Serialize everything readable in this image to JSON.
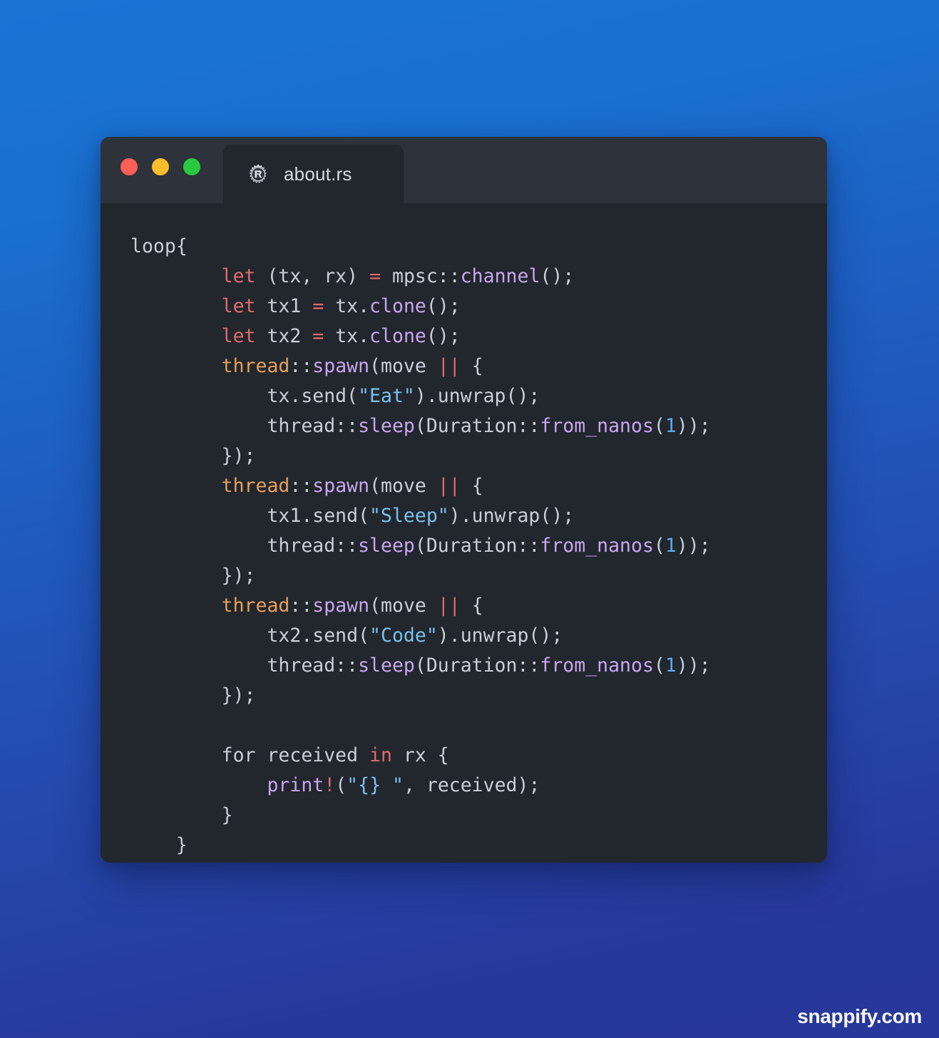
{
  "window": {
    "traffic_lights": [
      {
        "name": "close",
        "color": "#ff5f56"
      },
      {
        "name": "minimize",
        "color": "#fdbc2c"
      },
      {
        "name": "zoom",
        "color": "#27c93f"
      }
    ],
    "tab": {
      "icon": "rust-logo-icon",
      "label": "about.rs"
    }
  },
  "editor": {
    "language": "rust",
    "background": "#22262d",
    "titlebar_background": "#2e323b",
    "lines": [
      [
        {
          "t": "loop{",
          "c": "t-pl"
        }
      ],
      [
        {
          "t": "        ",
          "c": "t-pl"
        },
        {
          "t": "let",
          "c": "t-key"
        },
        {
          "t": " (tx, rx) ",
          "c": "t-pl"
        },
        {
          "t": "=",
          "c": "t-op"
        },
        {
          "t": " mpsc::",
          "c": "t-pl"
        },
        {
          "t": "channel",
          "c": "t-fn"
        },
        {
          "t": "();",
          "c": "t-pl"
        }
      ],
      [
        {
          "t": "        ",
          "c": "t-pl"
        },
        {
          "t": "let",
          "c": "t-key"
        },
        {
          "t": " tx1 ",
          "c": "t-pl"
        },
        {
          "t": "=",
          "c": "t-op"
        },
        {
          "t": " tx.",
          "c": "t-pl"
        },
        {
          "t": "clone",
          "c": "t-fn"
        },
        {
          "t": "();",
          "c": "t-pl"
        }
      ],
      [
        {
          "t": "        ",
          "c": "t-pl"
        },
        {
          "t": "let",
          "c": "t-key"
        },
        {
          "t": " tx2 ",
          "c": "t-pl"
        },
        {
          "t": "=",
          "c": "t-op"
        },
        {
          "t": " tx.",
          "c": "t-pl"
        },
        {
          "t": "clone",
          "c": "t-fn"
        },
        {
          "t": "();",
          "c": "t-pl"
        }
      ],
      [
        {
          "t": "        ",
          "c": "t-pl"
        },
        {
          "t": "thread",
          "c": "t-mod"
        },
        {
          "t": "::",
          "c": "t-pl"
        },
        {
          "t": "spawn",
          "c": "t-fn"
        },
        {
          "t": "(move ",
          "c": "t-pl"
        },
        {
          "t": "||",
          "c": "t-op"
        },
        {
          "t": " {",
          "c": "t-pl"
        }
      ],
      [
        {
          "t": "            tx.send(",
          "c": "t-pl"
        },
        {
          "t": "\"Eat\"",
          "c": "t-str"
        },
        {
          "t": ").unwrap();",
          "c": "t-pl"
        }
      ],
      [
        {
          "t": "            thread::",
          "c": "t-pl"
        },
        {
          "t": "sleep",
          "c": "t-fn"
        },
        {
          "t": "(Duration::",
          "c": "t-pl"
        },
        {
          "t": "from_nanos",
          "c": "t-fn"
        },
        {
          "t": "(",
          "c": "t-pl"
        },
        {
          "t": "1",
          "c": "t-num"
        },
        {
          "t": "));",
          "c": "t-pl"
        }
      ],
      [
        {
          "t": "        });",
          "c": "t-pl"
        }
      ],
      [
        {
          "t": "        ",
          "c": "t-pl"
        },
        {
          "t": "thread",
          "c": "t-mod"
        },
        {
          "t": "::",
          "c": "t-pl"
        },
        {
          "t": "spawn",
          "c": "t-fn"
        },
        {
          "t": "(move ",
          "c": "t-pl"
        },
        {
          "t": "||",
          "c": "t-op"
        },
        {
          "t": " {",
          "c": "t-pl"
        }
      ],
      [
        {
          "t": "            tx1.send(",
          "c": "t-pl"
        },
        {
          "t": "\"Sleep\"",
          "c": "t-str"
        },
        {
          "t": ").unwrap();",
          "c": "t-pl"
        }
      ],
      [
        {
          "t": "            thread::",
          "c": "t-pl"
        },
        {
          "t": "sleep",
          "c": "t-fn"
        },
        {
          "t": "(Duration::",
          "c": "t-pl"
        },
        {
          "t": "from_nanos",
          "c": "t-fn"
        },
        {
          "t": "(",
          "c": "t-pl"
        },
        {
          "t": "1",
          "c": "t-num"
        },
        {
          "t": "));",
          "c": "t-pl"
        }
      ],
      [
        {
          "t": "        });",
          "c": "t-pl"
        }
      ],
      [
        {
          "t": "        ",
          "c": "t-pl"
        },
        {
          "t": "thread",
          "c": "t-mod"
        },
        {
          "t": "::",
          "c": "t-pl"
        },
        {
          "t": "spawn",
          "c": "t-fn"
        },
        {
          "t": "(move ",
          "c": "t-pl"
        },
        {
          "t": "||",
          "c": "t-op"
        },
        {
          "t": " {",
          "c": "t-pl"
        }
      ],
      [
        {
          "t": "            tx2.send(",
          "c": "t-pl"
        },
        {
          "t": "\"Code\"",
          "c": "t-str"
        },
        {
          "t": ").unwrap();",
          "c": "t-pl"
        }
      ],
      [
        {
          "t": "            thread::",
          "c": "t-pl"
        },
        {
          "t": "sleep",
          "c": "t-fn"
        },
        {
          "t": "(Duration::",
          "c": "t-pl"
        },
        {
          "t": "from_nanos",
          "c": "t-fn"
        },
        {
          "t": "(",
          "c": "t-pl"
        },
        {
          "t": "1",
          "c": "t-num"
        },
        {
          "t": "));",
          "c": "t-pl"
        }
      ],
      [
        {
          "t": "        });",
          "c": "t-pl"
        }
      ],
      [],
      [
        {
          "t": "        for received ",
          "c": "t-pl"
        },
        {
          "t": "in",
          "c": "t-key"
        },
        {
          "t": " rx {",
          "c": "t-pl"
        }
      ],
      [
        {
          "t": "            ",
          "c": "t-pl"
        },
        {
          "t": "print",
          "c": "t-fn"
        },
        {
          "t": "!",
          "c": "t-op"
        },
        {
          "t": "(",
          "c": "t-pl"
        },
        {
          "t": "\"{} \"",
          "c": "t-str"
        },
        {
          "t": ", received);",
          "c": "t-pl"
        }
      ],
      [
        {
          "t": "        }",
          "c": "t-pl"
        }
      ],
      [
        {
          "t": "    }",
          "c": "t-pl"
        }
      ]
    ]
  },
  "watermark": {
    "text": "snappify.com"
  },
  "background": {
    "gradient_from": "#1a74d4",
    "gradient_to": "#27379a"
  }
}
